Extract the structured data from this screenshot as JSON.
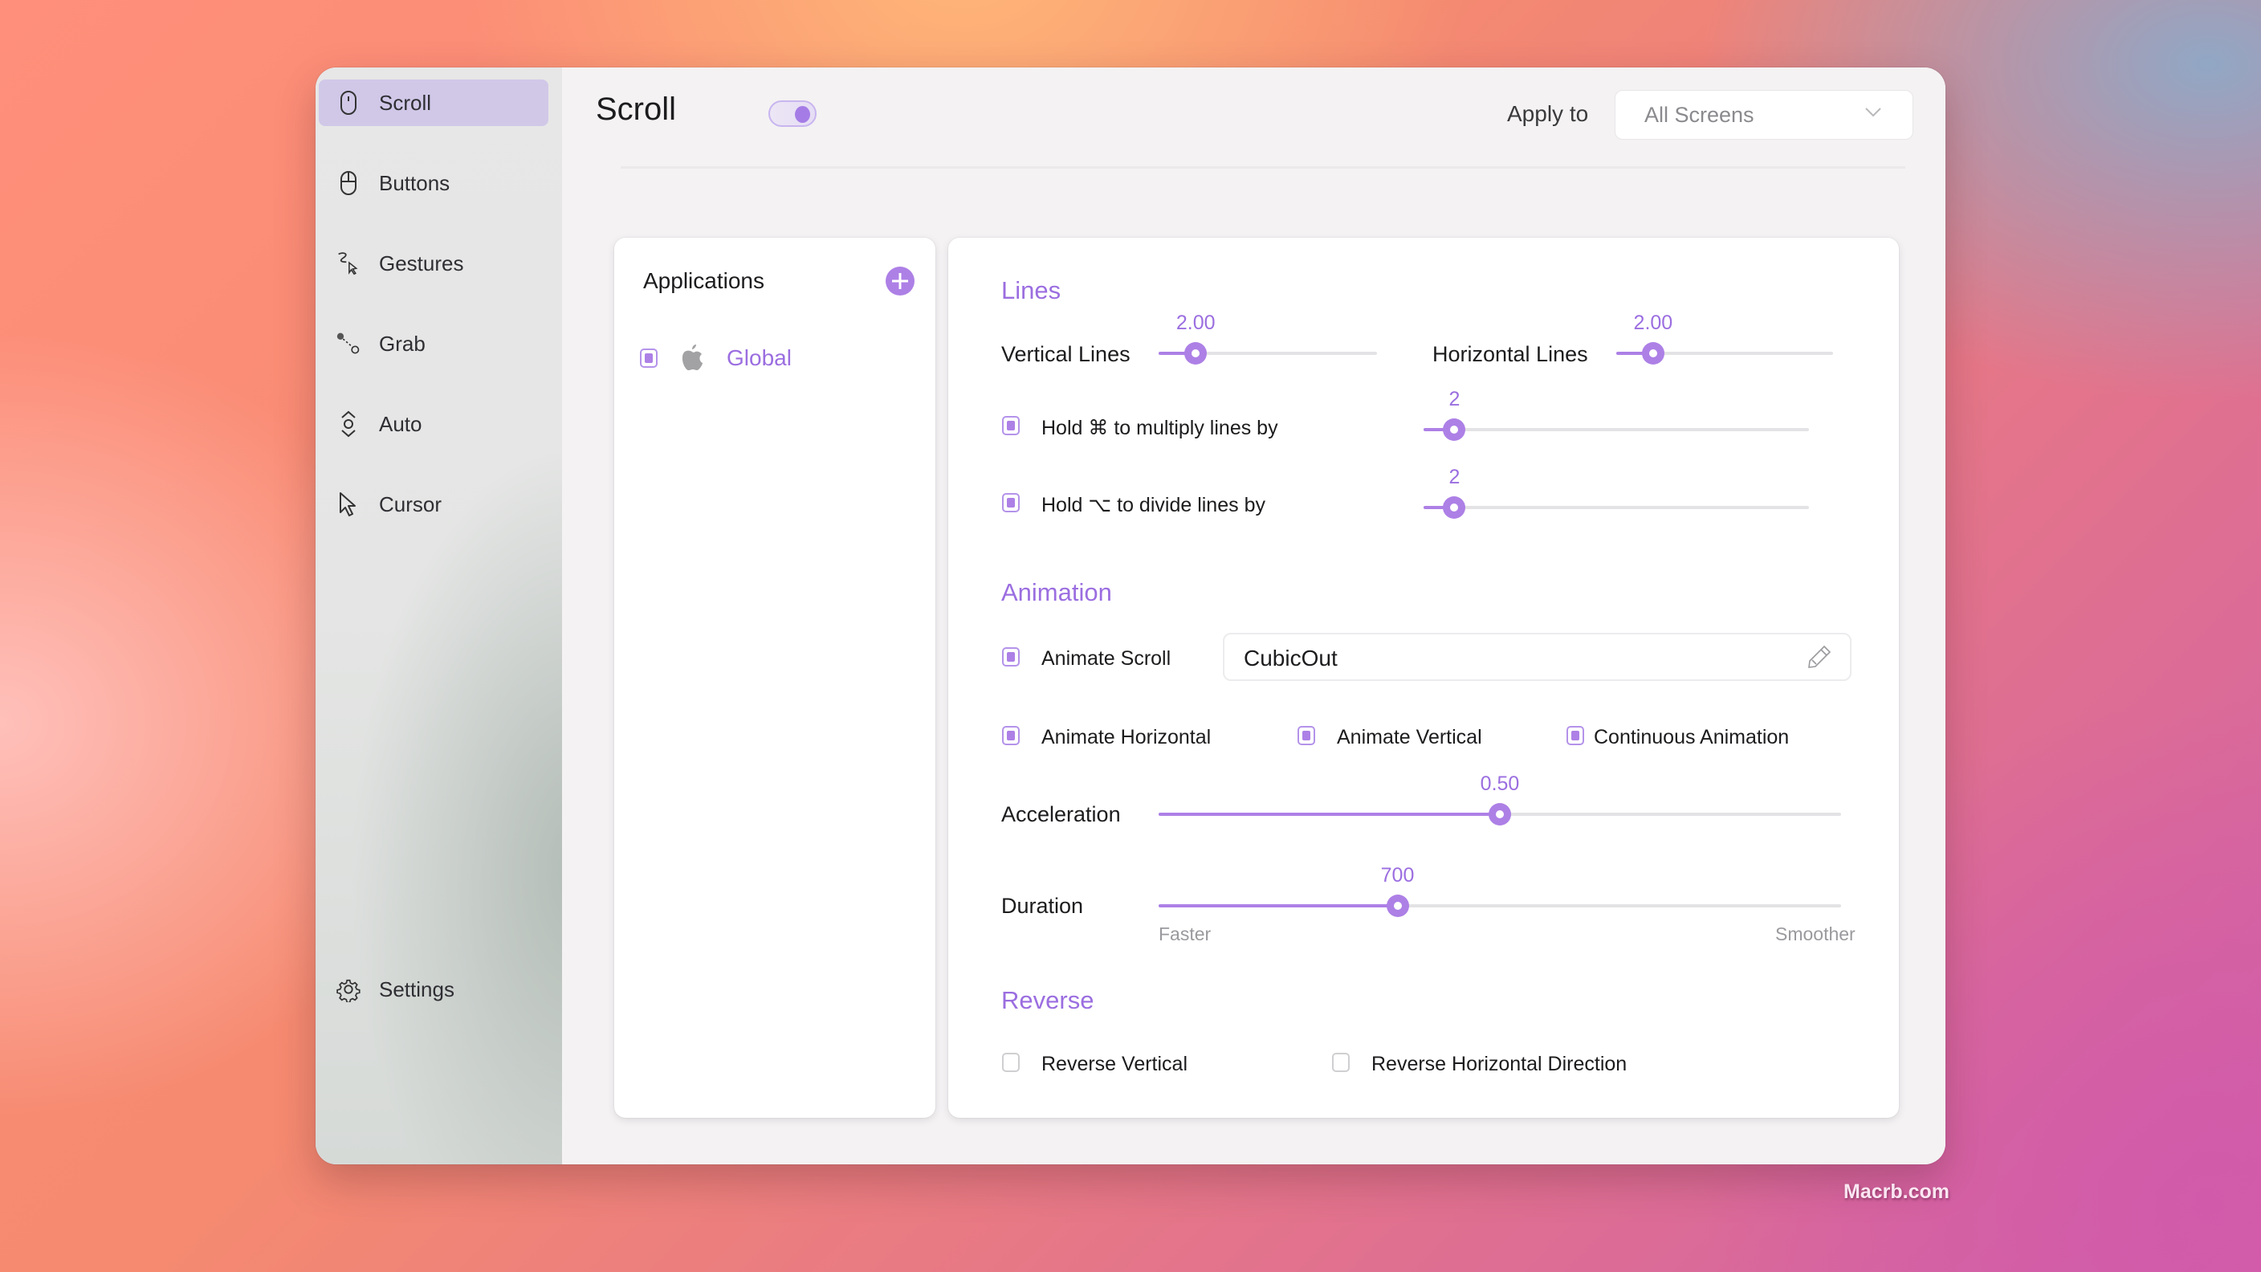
{
  "window": {
    "sidebar": {
      "items": [
        {
          "label": "Scroll",
          "icon": "mouse-scroll-icon",
          "active": true
        },
        {
          "label": "Buttons",
          "icon": "mouse-buttons-icon",
          "active": false
        },
        {
          "label": "Gestures",
          "icon": "gesture-icon",
          "active": false
        },
        {
          "label": "Grab",
          "icon": "grab-icon",
          "active": false
        },
        {
          "label": "Auto",
          "icon": "auto-scroll-icon",
          "active": false
        },
        {
          "label": "Cursor",
          "icon": "cursor-icon",
          "active": false
        }
      ],
      "settings_label": "Settings"
    },
    "header": {
      "title": "Scroll",
      "enabled": true,
      "apply_to_label": "Apply to",
      "apply_to_value": "All Screens"
    },
    "applications": {
      "title": "Applications",
      "items": [
        {
          "label": "Global",
          "checked": true,
          "icon": "apple-icon"
        }
      ]
    },
    "lines": {
      "section_title": "Lines",
      "vertical": {
        "label": "Vertical Lines",
        "value": "2.00",
        "fraction": 0.17
      },
      "horizontal": {
        "label": "Horizontal Lines",
        "value": "2.00",
        "fraction": 0.17
      },
      "multiply": {
        "label_prefix": "Hold",
        "key": "⌘",
        "label_suffix": "to multiply lines by",
        "checked": true,
        "value": "2",
        "fraction": 0.08
      },
      "divide": {
        "label_prefix": "Hold",
        "key": "⌥",
        "label_suffix": "to divide lines by",
        "checked": true,
        "value": "2",
        "fraction": 0.08
      }
    },
    "animation": {
      "section_title": "Animation",
      "animate_scroll": {
        "label": "Animate Scroll",
        "checked": true
      },
      "easing_value": "CubicOut",
      "animate_horizontal": {
        "label": "Animate Horizontal",
        "checked": true
      },
      "animate_vertical": {
        "label": "Animate Vertical",
        "checked": true
      },
      "continuous": {
        "label": "Continuous Animation",
        "checked": true
      },
      "acceleration": {
        "label": "Acceleration",
        "value": "0.50",
        "fraction": 0.5
      },
      "duration": {
        "label": "Duration",
        "value": "700",
        "fraction": 0.35,
        "min_hint": "Faster",
        "max_hint": "Smoother"
      }
    },
    "reverse": {
      "section_title": "Reverse",
      "vertical": {
        "label": "Reverse Vertical",
        "checked": false
      },
      "horizontal": {
        "label": "Reverse Horizontal Direction",
        "checked": false
      }
    }
  },
  "watermark": "Macrb.com",
  "colors": {
    "accent": "#ad80e6",
    "accent_text": "#9b6ee0",
    "active_nav": "#d1c8e8"
  }
}
